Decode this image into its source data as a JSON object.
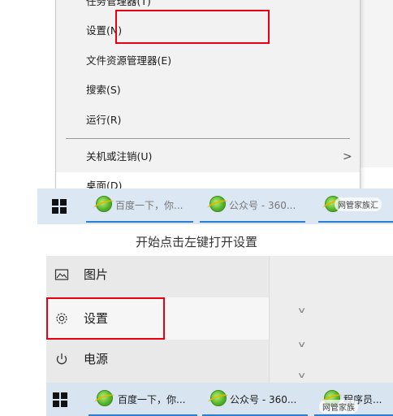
{
  "top": {
    "menu_items": [
      {
        "label": "任务管理器(T)"
      },
      {
        "label": "设置(N)"
      },
      {
        "label": "文件资源管理器(E)"
      },
      {
        "label": "搜索(S)"
      },
      {
        "label": "运行(R)"
      },
      {
        "label": "关机或注销(U)"
      },
      {
        "label": "桌面(D)"
      }
    ],
    "chevron": ">",
    "taskbar": {
      "items": [
        {
          "label": "百度一下，你..."
        },
        {
          "label": "公众号 - 360..."
        }
      ],
      "watermark": "网管家族汇"
    }
  },
  "caption": "开始点击左键打开设置",
  "bottom": {
    "menu_items": [
      {
        "label": "图片",
        "icon": "image-icon"
      },
      {
        "label": "设置",
        "icon": "gear-icon"
      },
      {
        "label": "电源",
        "icon": "power-icon"
      }
    ],
    "taskbar": {
      "items": [
        {
          "label": "百度一下，你..."
        },
        {
          "label": "公众号 - 360..."
        },
        {
          "label": "程序员..."
        }
      ],
      "watermark": "网管家族"
    }
  },
  "colors": {
    "highlight_box": "#e60012",
    "taskbar": "#d8e5f1",
    "underline": "#2f7dd1"
  }
}
